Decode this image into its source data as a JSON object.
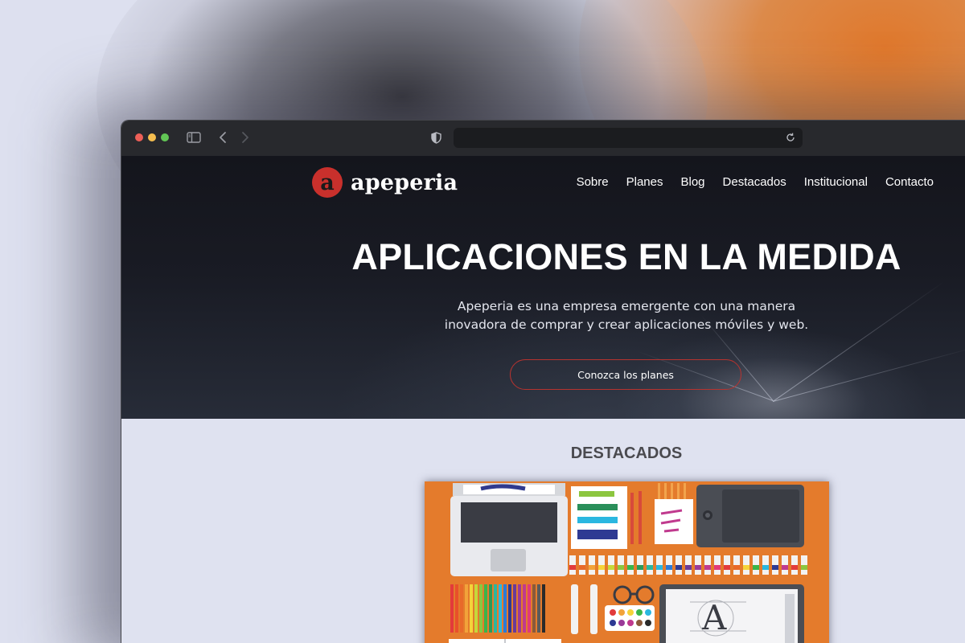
{
  "browser": {
    "url": "",
    "colors": {
      "titlebar": "#28292d",
      "urlbar": "#1b1c1f"
    }
  },
  "site": {
    "logo_letter": "a",
    "logo_name": "apeperia",
    "brand_color": "#c9302c",
    "nav": [
      "Sobre",
      "Planes",
      "Blog",
      "Destacados",
      "Institucional",
      "Contacto"
    ],
    "hero": {
      "title": "APLICACIONES EN LA MEDIDA",
      "subtitle_line1": "Apeperia es una empresa emergente con una manera",
      "subtitle_line2": "inovadora de comprar y crear aplicaciones móviles y web.",
      "cta_label": "Conozca los planes"
    },
    "featured": {
      "title": "DESTACADOS",
      "illustration": "designer-desk-illustration",
      "illustration_bg": "#e47b2c"
    }
  }
}
